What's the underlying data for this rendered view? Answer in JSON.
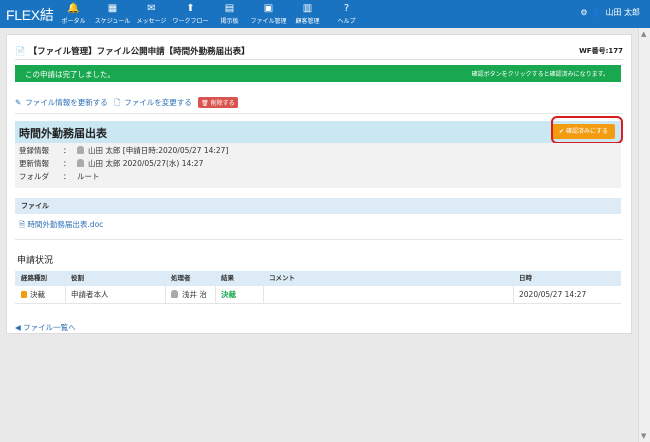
{
  "app": {
    "logo": "FLEX結",
    "user": "山田 太郎"
  },
  "nav": [
    {
      "label": "ポータル",
      "icon": "🔔"
    },
    {
      "label": "スケジュール",
      "icon": "▦"
    },
    {
      "label": "メッセージ",
      "icon": "✉"
    },
    {
      "label": "ワークフロー",
      "icon": "⬆"
    },
    {
      "label": "掲示板",
      "icon": "▤"
    },
    {
      "label": "ファイル管理",
      "icon": "▣"
    },
    {
      "label": "顧客管理",
      "icon": "▥"
    },
    {
      "label": "ヘルプ",
      "icon": "?"
    }
  ],
  "page": {
    "title": "【ファイル管理】ファイル公開申請【時間外勤務届出表】",
    "wf_no": "WF番号:177"
  },
  "alert": {
    "message": "この申請は完了しました。",
    "hint": "確認ボタンをクリックすると確認済みになります。",
    "color": "#19a84f"
  },
  "actions": {
    "update_info": "ファイル情報を更新する",
    "change_file": "ファイルを変更する",
    "delete": "削除する"
  },
  "doc": {
    "title": "時間外勤務届出表",
    "confirm_button": "確認済みにする",
    "rows": [
      {
        "label": "登録情報",
        "colon": "：",
        "value": "山田 太郎 [申請日時:2020/05/27 14:27]"
      },
      {
        "label": "更新情報",
        "colon": "：",
        "value": "山田 太郎 2020/05/27(水) 14:27"
      },
      {
        "label": "フォルダ",
        "colon": "：",
        "value": "ルート"
      }
    ]
  },
  "file": {
    "header": "ファイル",
    "name": "時間外勤務届出表.doc"
  },
  "status": {
    "section": "申請状況",
    "headers": [
      "経路種別",
      "役割",
      "処理者",
      "結果",
      "コメント",
      "日時"
    ],
    "row": {
      "type": "決裁",
      "role": "申請者本人",
      "handler": "浅井 治",
      "result": "決裁",
      "comment": "",
      "datetime": "2020/05/27 14:27"
    }
  },
  "back": "ファイル一覧へ"
}
